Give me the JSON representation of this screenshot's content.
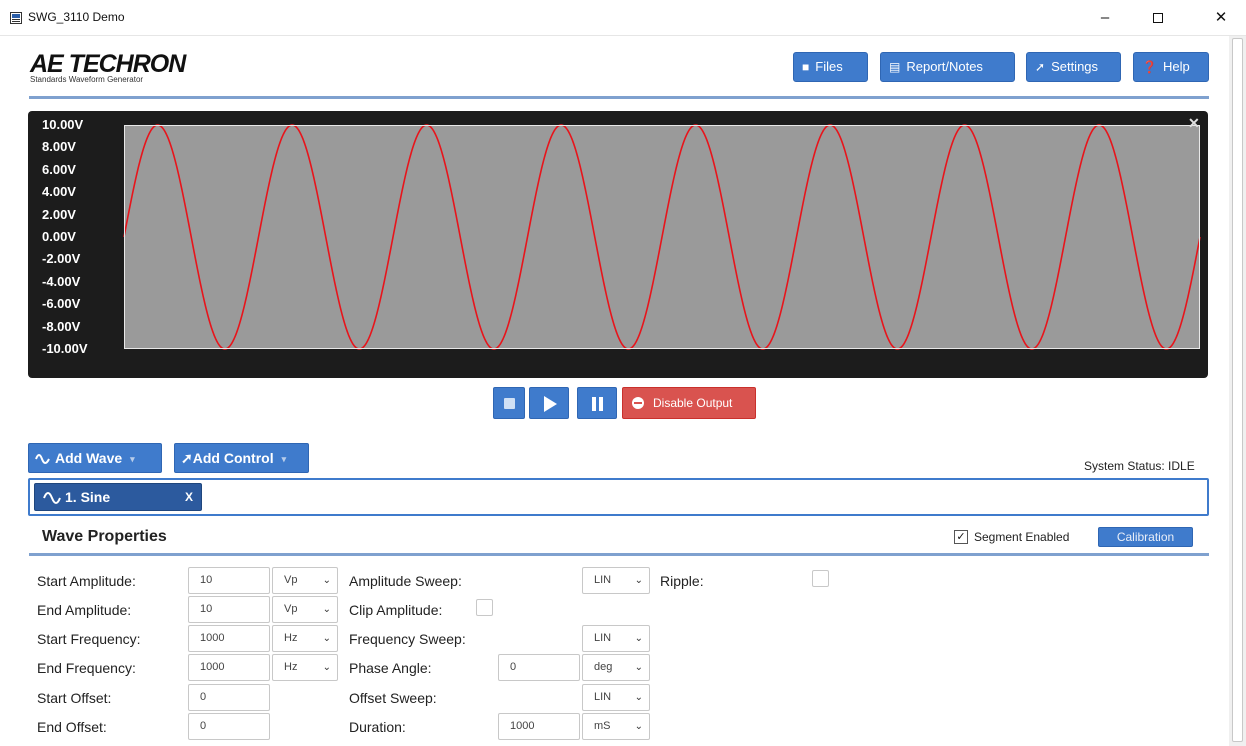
{
  "window": {
    "title": "SWG_3110 Demo",
    "min_glyph": "–",
    "close_glyph": "✕"
  },
  "logo": {
    "main": "AE TECHRON",
    "sub": "Standards Waveform Generator"
  },
  "toolbar": {
    "files": "Files",
    "report": "Report/Notes",
    "settings": "Settings",
    "help": "Help",
    "icons": {
      "files": "folder-icon",
      "report": "clipboard-icon",
      "settings": "wrench-icon",
      "help": "question-icon"
    }
  },
  "scope": {
    "close_glyph": "✕",
    "y_ticks": [
      "10.00V",
      "8.00V",
      "6.00V",
      "4.00V",
      "2.00V",
      "0.00V",
      "-2.00V",
      "-4.00V",
      "-6.00V",
      "-8.00V",
      "-10.00V"
    ],
    "trace_color": "#e8141b",
    "plot_bg": "#9a9a9a"
  },
  "chart_data": {
    "type": "line",
    "title": "",
    "xlabel": "",
    "ylabel": "",
    "ylim": [
      -10,
      10
    ],
    "series": [
      {
        "waveform": "sine",
        "amplitude": 10,
        "cycles_shown": 8,
        "start_phase_deg": 0
      }
    ],
    "grid": false
  },
  "controls": {
    "disable_output": "Disable Output"
  },
  "add": {
    "wave": "Add Wave",
    "control": "Add Control",
    "caret": "▾"
  },
  "status": "System Status: IDLE",
  "tabs": [
    {
      "label": "1. Sine",
      "close": "X"
    }
  ],
  "wave_properties": {
    "title": "Wave Properties",
    "segment_enabled_label": "Segment Enabled",
    "segment_enabled_mark": "✓",
    "calibration": "Calibration",
    "labels": {
      "start_amplitude": "Start Amplitude:",
      "end_amplitude": "End Amplitude:",
      "start_frequency": "Start Frequency:",
      "end_frequency": "End Frequency:",
      "start_offset": "Start Offset:",
      "end_offset": "End Offset:",
      "amplitude_sweep": "Amplitude Sweep:",
      "clip_amplitude": "Clip Amplitude:",
      "frequency_sweep": "Frequency Sweep:",
      "phase_angle": "Phase Angle:",
      "offset_sweep": "Offset Sweep:",
      "duration": "Duration:",
      "ripple": "Ripple:"
    },
    "values": {
      "start_amplitude": "10",
      "end_amplitude": "10",
      "start_frequency": "1000",
      "end_frequency": "1000",
      "start_offset": "0",
      "end_offset": "0",
      "phase_angle": "0",
      "duration": "1000"
    },
    "units": {
      "start_amplitude": "Vp",
      "end_amplitude": "Vp",
      "start_frequency": "Hz",
      "end_frequency": "Hz",
      "phase_angle": "deg",
      "duration": "mS"
    },
    "sweeps": {
      "amplitude": "LIN",
      "frequency": "LIN",
      "offset": "LIN"
    },
    "dropdown_glyph": "⌄"
  }
}
